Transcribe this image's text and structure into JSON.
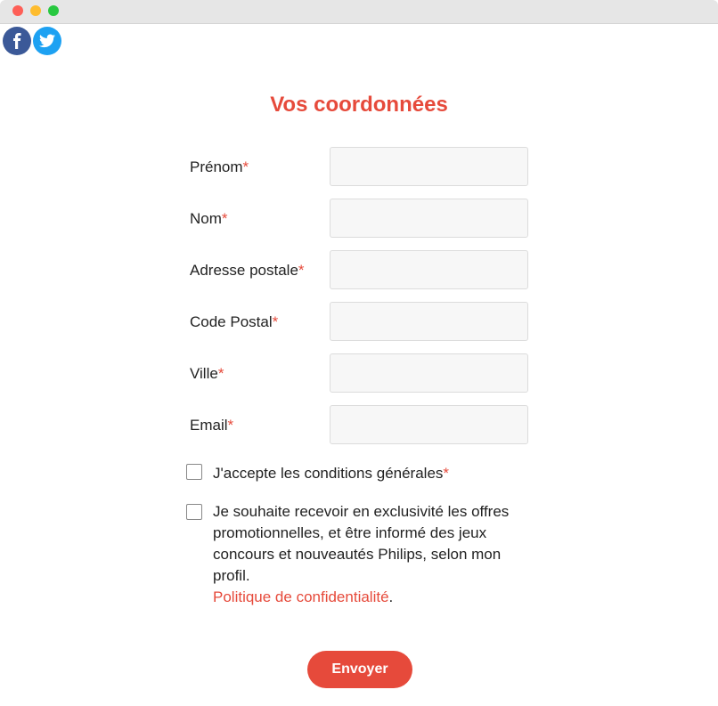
{
  "window": {
    "controls": [
      "close",
      "minimize",
      "maximize"
    ]
  },
  "social": {
    "facebook_icon": "facebook-icon",
    "twitter_icon": "twitter-icon"
  },
  "form": {
    "title": "Vos coordonnées",
    "required_mark": "*",
    "fields": [
      {
        "label": "Prénom",
        "value": ""
      },
      {
        "label": "Nom",
        "value": ""
      },
      {
        "label": "Adresse postale",
        "value": ""
      },
      {
        "label": "Code Postal",
        "value": ""
      },
      {
        "label": "Ville",
        "value": ""
      },
      {
        "label": "Email",
        "value": ""
      }
    ],
    "terms": {
      "label": "J'accepte les conditions générales",
      "checked": false
    },
    "optin": {
      "label": "Je souhaite recevoir en exclusivité les offres promotionnelles, et être informé des jeux concours et nouveautés Philips, selon mon profil.",
      "privacy_link": "Politique de confidentialité",
      "trailing": ".",
      "checked": false
    },
    "submit_label": "Envoyer"
  },
  "colors": {
    "accent": "#e64a3b",
    "facebook": "#3b5998",
    "twitter": "#1da1f2"
  }
}
